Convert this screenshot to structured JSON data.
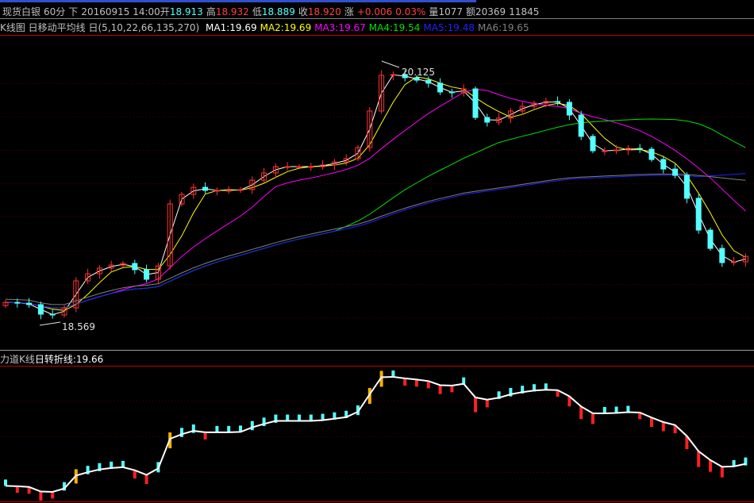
{
  "header": {
    "name": "现货白银",
    "period": "60分",
    "dir": "下",
    "datetime": "20160915 14:00",
    "open_label": "开",
    "open": "18.913",
    "high_label": "高",
    "high": "18.932",
    "low_label": "低",
    "low": "18.889",
    "close_label": "收",
    "close": "18.920",
    "change_label": "涨",
    "change": "+0.006",
    "change_pct": "0.03%",
    "vol_label": "量",
    "vol": "1077",
    "amt_label": "额",
    "amt": "20369",
    "extra": "11845"
  },
  "legend": {
    "title": "K线图 日移动平均线 日(5,10,22,66,135,270)",
    "ma": [
      {
        "t": "MA1:19.69",
        "c": "#ffffff"
      },
      {
        "t": "MA2:19.69",
        "c": "#ffff00"
      },
      {
        "t": "MA3:19.67",
        "c": "#ff00ff"
      },
      {
        "t": "MA4:19.54",
        "c": "#00e000"
      },
      {
        "t": "MA5:19.48",
        "c": "#2020ff"
      },
      {
        "t": "MA6:19.65",
        "c": "#808080"
      }
    ]
  },
  "sub_legend": {
    "title": "力道K线",
    "line": "日转折线:19.66"
  },
  "chart_data": {
    "type": "candlestick",
    "ylim": [
      18.397,
      20.336
    ],
    "annotations": {
      "max": "20.125",
      "min": "18.569"
    },
    "up_color": "#ff3232",
    "down_color": "#54ffff",
    "closes": [
      18.686,
      18.681,
      18.672,
      18.613,
      18.608,
      18.652,
      18.819,
      18.863,
      18.898,
      18.917,
      18.927,
      18.888,
      18.829,
      18.912,
      19.295,
      19.354,
      19.398,
      19.379,
      19.379,
      19.379,
      19.384,
      19.442,
      19.487,
      19.526,
      19.526,
      19.526,
      19.526,
      19.536,
      19.555,
      19.575,
      19.644,
      19.87,
      20.091,
      20.096,
      20.076,
      20.061,
      20.042,
      19.988,
      19.983,
      20.007,
      19.83,
      19.801,
      19.826,
      19.87,
      19.899,
      19.919,
      19.929,
      19.924,
      19.845,
      19.713,
      19.624,
      19.624,
      19.629,
      19.639,
      19.634,
      19.57,
      19.511,
      19.472,
      19.33,
      19.133,
      19.02,
      18.932,
      18.937,
      18.971
    ]
  }
}
